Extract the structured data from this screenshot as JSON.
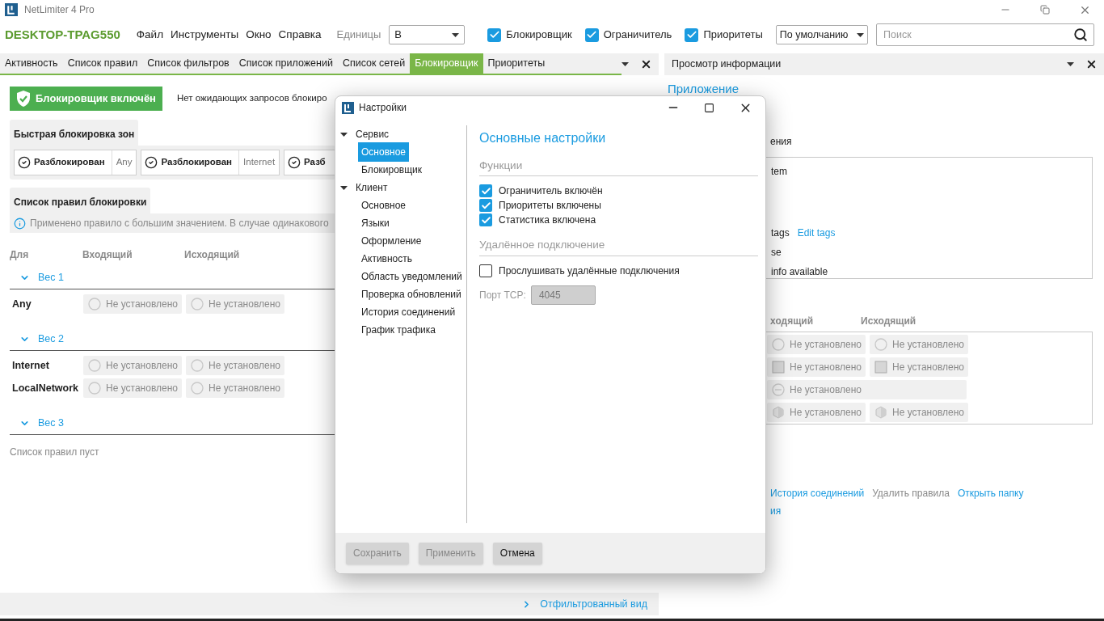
{
  "window": {
    "title": "NetLimiter 4 Pro"
  },
  "toolbar": {
    "machine": "DESKTOP-TPAG550",
    "menu": [
      "Файл",
      "Инструменты",
      "Окно",
      "Справка"
    ],
    "units_label": "Единицы",
    "units_value": "B",
    "toggles": [
      {
        "label": "Блокировщик",
        "checked": true
      },
      {
        "label": "Ограничитель",
        "checked": true
      },
      {
        "label": "Приоритеты",
        "checked": true
      }
    ],
    "profile": "По умолчанию",
    "search": {
      "placeholder": "Поиск"
    }
  },
  "left_panel": {
    "tabs": [
      {
        "label": "Активность",
        "selected": false
      },
      {
        "label": "Список правил",
        "selected": false
      },
      {
        "label": "Список фильтров",
        "selected": false
      },
      {
        "label": "Список приложений",
        "selected": false
      },
      {
        "label": "Список сетей",
        "selected": false
      },
      {
        "label": "Блокировщик",
        "selected": true
      },
      {
        "label": "Приоритеты",
        "selected": false
      }
    ],
    "blocker_button": {
      "label": "Блокировщик включён",
      "on": true
    },
    "pending_text": "Нет ожидающих запросов блокиро",
    "quick_zones": {
      "title": "Быстрая блокировка зон",
      "items": [
        {
          "state": "Разблокирован",
          "zone": "Any"
        },
        {
          "state": "Разблокирован",
          "zone": "Internet"
        },
        {
          "state": "Разб"
        }
      ]
    },
    "rules": {
      "title": "Список правил блокировки",
      "info": "Применено правило с большим значением. В случае одинакового",
      "columns": [
        "Для",
        "Входящий",
        "Исходящий"
      ],
      "groups": [
        {
          "label": "Вес 1",
          "expanded": true,
          "rows": [
            {
              "name": "Any",
              "incoming": "Не установлено",
              "outgoing": "Не установлено"
            }
          ]
        },
        {
          "label": "Вес 2",
          "expanded": true,
          "rows": [
            {
              "name": "Internet",
              "incoming": "Не установлено",
              "outgoing": "Не установлено"
            },
            {
              "name": "LocalNetwork",
              "incoming": "Не установлено",
              "outgoing": "Не установлено"
            }
          ]
        },
        {
          "label": "Вес 3",
          "expanded": true
        }
      ],
      "empty_text": "Список правил пуст"
    },
    "footer_link": "Отфильтрованный вид"
  },
  "right_panel": {
    "title": "Просмотр информации",
    "heading": "Приложение",
    "fragment": "ения",
    "info_lines": [
      {
        "text": "tem"
      },
      {
        "text": "tags",
        "link": "Edit tags"
      },
      {
        "text": "se"
      },
      {
        "text": "info available"
      }
    ],
    "rule_columns": [
      "ходящий",
      "Исходящий"
    ],
    "rule_rows": [
      {
        "kind": "radio",
        "incoming": "Не установлено",
        "outgoing": "Не установлено"
      },
      {
        "kind": "square",
        "incoming": "Не установлено",
        "outgoing": "Не установлено"
      },
      {
        "kind": "minus",
        "incoming": "Не установлено"
      },
      {
        "kind": "hexagon",
        "incoming": "Не установлено",
        "outgoing": "Не установлено"
      }
    ],
    "links": [
      {
        "text": "История соединений",
        "disabled": false
      },
      {
        "text": "Удалить правила",
        "disabled": true
      },
      {
        "text": "Открыть папку",
        "disabled": false
      }
    ],
    "link_fragment": "ия"
  },
  "dialog": {
    "title": "Настройки",
    "tree": [
      {
        "label": "Сервис",
        "expanded": true,
        "selected": false,
        "children": [
          {
            "label": "Основное",
            "selected": true
          },
          {
            "label": "Блокировщик",
            "selected": false
          }
        ]
      },
      {
        "label": "Клиент",
        "expanded": true,
        "selected": false,
        "children": [
          {
            "label": "Основное",
            "selected": false
          },
          {
            "label": "Языки",
            "selected": false
          },
          {
            "label": "Оформление",
            "selected": false
          },
          {
            "label": "Активность",
            "selected": false
          },
          {
            "label": "Область уведомлений",
            "selected": false
          },
          {
            "label": "Проверка обновлений",
            "selected": false
          },
          {
            "label": "История соединений",
            "selected": false
          },
          {
            "label": "График трафика",
            "selected": false
          }
        ]
      }
    ],
    "heading": "Основные настройки",
    "sections": [
      {
        "title": "Функции",
        "options": [
          {
            "label": "Ограничитель включён",
            "checked": true
          },
          {
            "label": "Приоритеты включены",
            "checked": true
          },
          {
            "label": "Статистика включена",
            "checked": true
          }
        ]
      },
      {
        "title": "Удалённое подключение",
        "options": [
          {
            "label": "Прослушивать удалённые подключения",
            "checked": false
          }
        ],
        "port": {
          "label": "Порт TCP:",
          "value": "4045",
          "disabled": true
        }
      }
    ],
    "buttons": [
      {
        "label": "Сохранить",
        "disabled": true
      },
      {
        "label": "Применить",
        "disabled": true
      },
      {
        "label": "Отмена",
        "disabled": false
      }
    ]
  }
}
